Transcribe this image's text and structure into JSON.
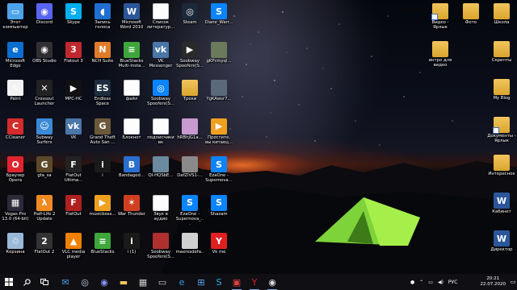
{
  "desktop": {
    "icons": [
      {
        "label": "Этот компьютер",
        "icon": "computer-icon",
        "color": "#4da3e8",
        "glyph": "▭"
      },
      {
        "label": "Discord",
        "icon": "discord-icon",
        "color": "#5865f2",
        "glyph": "◉"
      },
      {
        "label": "Skype",
        "icon": "skype-icon",
        "color": "#00aff0",
        "glyph": "S"
      },
      {
        "label": "Запись голоса",
        "icon": "voice-recorder-icon",
        "color": "#1f6fd0",
        "glyph": "◖"
      },
      {
        "label": "Microsoft Word 2010",
        "icon": "word-icon",
        "color": "#2b579a",
        "glyph": "W"
      },
      {
        "label": "Список литератур...",
        "icon": "document-icon",
        "color": "doc",
        "glyph": ""
      },
      {
        "label": "Steam",
        "icon": "steam-icon",
        "color": "#1b2838",
        "glyph": "◎"
      },
      {
        "label": "Diane_Warr...",
        "icon": "shazam-icon",
        "color": "#0a84ff",
        "glyph": "S"
      },
      {
        "label": "Microsoft Edge",
        "icon": "edge-icon",
        "color": "#0a6ed1",
        "glyph": "e"
      },
      {
        "label": "OBS Studio",
        "icon": "obs-icon",
        "color": "#302e31",
        "glyph": "◉"
      },
      {
        "label": "Flatout 3",
        "icon": "flatout3-icon",
        "color": "#c0282d",
        "glyph": "3"
      },
      {
        "label": "NCH Suite",
        "icon": "nch-icon",
        "color": "#e07b2a",
        "glyph": "N"
      },
      {
        "label": "BlueStacks Multi-Insta...",
        "icon": "bluestacks-icon",
        "color": "#3ea63a",
        "glyph": "≡"
      },
      {
        "label": "VK Messenger",
        "icon": "vk-icon",
        "color": "#4a76a8",
        "glyph": "vk"
      },
      {
        "label": "Soobway Spoofers(S...",
        "icon": "media-file-icon",
        "color": "#2a2a2a",
        "glyph": "▶"
      },
      {
        "label": "gKPcmyql...",
        "icon": "image-file-icon",
        "color": "#6a7a5a",
        "glyph": ""
      },
      {
        "label": "Paint",
        "icon": "paint-icon",
        "color": "#f3f3f3",
        "glyph": "✎"
      },
      {
        "label": "Crossout Launcher",
        "icon": "crossout-icon",
        "color": "#222",
        "glyph": "✕"
      },
      {
        "label": "MPC-HC",
        "icon": "mpc-icon",
        "color": "#111",
        "glyph": "▶"
      },
      {
        "label": "Endless Space",
        "icon": "endless-space-icon",
        "color": "#1d2e40",
        "glyph": "ES"
      },
      {
        "label": "файл",
        "icon": "document-icon",
        "color": "doc",
        "glyph": ""
      },
      {
        "label": "Soobway Spoofers(S...",
        "icon": "media-file-icon",
        "color": "#0a84ff",
        "glyph": "◎"
      },
      {
        "label": "Треки",
        "icon": "folder-icon",
        "color": "folder",
        "glyph": ""
      },
      {
        "label": "YgKAwsr7...",
        "icon": "image-file-icon",
        "color": "#5a6a7a",
        "glyph": ""
      },
      {
        "label": "CCleaner",
        "icon": "ccleaner-icon",
        "color": "#d62b2b",
        "glyph": "C"
      },
      {
        "label": "Subway Surfers",
        "icon": "subway-surfers-icon",
        "color": "#3b8ad6",
        "glyph": "☺"
      },
      {
        "label": "VK",
        "icon": "vk-icon",
        "color": "#4a76a8",
        "glyph": "vk"
      },
      {
        "label": "Grand Theft Auto San ...",
        "icon": "gta-sa-icon",
        "color": "#6b5a3a",
        "glyph": "G"
      },
      {
        "label": "Блокнот",
        "icon": "document-icon",
        "color": "doc",
        "glyph": ""
      },
      {
        "label": "подписчики вк",
        "icon": "document-icon",
        "color": "doc",
        "glyph": ""
      },
      {
        "label": "hRBhJG1a...",
        "icon": "image-file-icon",
        "color": "#c89ad0",
        "glyph": ""
      },
      {
        "label": "Простите, вы китаец...",
        "icon": "media-file-icon",
        "color": "#f0a020",
        "glyph": "▶"
      },
      {
        "label": "Браузер Opera",
        "icon": "opera-icon",
        "color": "#e0242f",
        "glyph": "O"
      },
      {
        "label": "gta_sa",
        "icon": "gta-sa-icon",
        "color": "#5a4a2a",
        "glyph": "G"
      },
      {
        "label": "FlatOut Ultima...",
        "icon": "flatout-icon",
        "color": "#222",
        "glyph": "F"
      },
      {
        "label": "i",
        "icon": "game-icon",
        "color": "#1a1a1a",
        "glyph": "i"
      },
      {
        "label": "Bandaged...",
        "icon": "bandage-icon",
        "color": "#2a6fd0",
        "glyph": "B"
      },
      {
        "label": "QI-HQSbE...",
        "icon": "image-file-icon",
        "color": "#6a8aa0",
        "glyph": ""
      },
      {
        "label": "DafZlVS1-...",
        "icon": "image-file-icon",
        "color": "#8a8a8a",
        "glyph": ""
      },
      {
        "label": "EzaOne - Supernova...",
        "icon": "media-file-icon",
        "color": "#0a84ff",
        "glyph": "S"
      },
      {
        "label": "Vegas Pro 13.0 (64-bit)",
        "icon": "vegas-icon",
        "color": "#2a2a3a",
        "glyph": "▦"
      },
      {
        "label": "Half-Life 2 Update",
        "icon": "half-life-icon",
        "color": "#f08a20",
        "glyph": "λ"
      },
      {
        "label": "FlatOut",
        "icon": "flatout-icon",
        "color": "#b02020",
        "glyph": "F"
      },
      {
        "label": "musicboss...",
        "icon": "media-file-icon",
        "color": "#f0a020",
        "glyph": "▶"
      },
      {
        "label": "War Thunder",
        "icon": "war-thunder-icon",
        "color": "#d04020",
        "glyph": "✶"
      },
      {
        "label": "Звук в аудио",
        "icon": "document-icon",
        "color": "doc",
        "glyph": ""
      },
      {
        "label": "EzaOne - Supernova_...",
        "icon": "media-file-icon",
        "color": "#0a84ff",
        "glyph": "S"
      },
      {
        "label": "Shazam",
        "icon": "shazam-icon",
        "color": "#0a84ff",
        "glyph": "S"
      },
      {
        "label": "Корзина",
        "icon": "recycle-bin-icon",
        "color": "#9ab8d8",
        "glyph": "♲"
      },
      {
        "label": "FlatOut 2",
        "icon": "flatout2-icon",
        "color": "#333",
        "glyph": "2"
      },
      {
        "label": "VLC media player",
        "icon": "vlc-icon",
        "color": "#f08000",
        "glyph": "▲"
      },
      {
        "label": "BlueStacks",
        "icon": "bluestacks-icon",
        "color": "#3ea63a",
        "glyph": "≡"
      },
      {
        "label": "i (1)",
        "icon": "game-icon",
        "color": "#1a1a1a",
        "glyph": "i"
      },
      {
        "label": "Soobway Spoofers(S...",
        "icon": "image-file-icon",
        "color": "#b03030",
        "glyph": ""
      },
      {
        "label": "maxresdefa...",
        "icon": "image-file-icon",
        "color": "#d0d0d0",
        "glyph": ""
      },
      {
        "label": "Vk me",
        "icon": "yandex-icon",
        "color": "#e02020",
        "glyph": "Y"
      }
    ],
    "right_icons": [
      {
        "label": "Видео - Ярлык",
        "icon": "folder-shortcut-icon"
      },
      {
        "label": "Фото",
        "icon": "folder-icon"
      },
      {
        "label": "Школа",
        "icon": "folder-icon"
      },
      {
        "label": "интро для видео",
        "icon": "folder-icon"
      },
      {
        "label": "Скрипты",
        "icon": "folder-icon"
      },
      {
        "label": "My Blog",
        "icon": "folder-icon"
      },
      {
        "label": "Документы - Ярлык",
        "icon": "folder-shortcut-icon"
      },
      {
        "label": "Интересное",
        "icon": "folder-icon"
      },
      {
        "label": "Кабинет",
        "icon": "word-icon"
      },
      {
        "label": "Директор",
        "icon": "word-icon"
      }
    ]
  },
  "taskbar": {
    "tray": {
      "lang": "РУС"
    },
    "clock": {
      "time": "20:21",
      "date": "22.07.2020"
    }
  }
}
